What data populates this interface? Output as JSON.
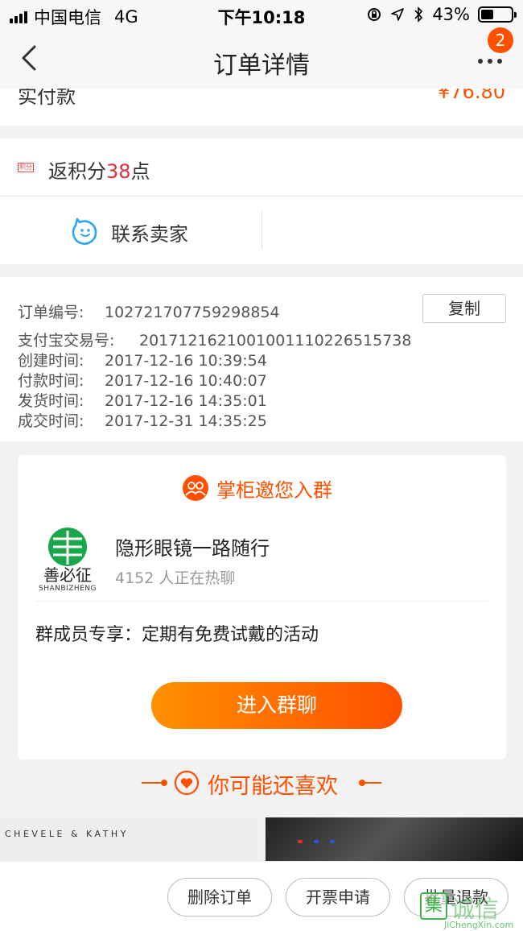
{
  "status_bar": {
    "carrier": "中国电信",
    "network": "4G",
    "time": "下午10:18",
    "battery_percent": "43%",
    "battery_level": 0.43
  },
  "nav": {
    "title": "订单详情",
    "badge_count": "2",
    "back_icon": "chevron-left-icon",
    "more_icon": "more-dots-icon"
  },
  "payment": {
    "label": "实付款",
    "value": "¥76.80"
  },
  "points": {
    "icon_text": "积分",
    "prefix": "返积分",
    "amount": "38",
    "suffix": "点"
  },
  "contact": {
    "label": "联系卖家",
    "icon": "chat-bubble-icon"
  },
  "order_info": {
    "copy_label": "复制",
    "lines": [
      {
        "label": "订单编号:",
        "value": "102721707759298854"
      },
      {
        "label": "支付宝交易号:",
        "value": "2017121621001001110226515738"
      },
      {
        "label": "创建时间:",
        "value": "2017-12-16 10:39:54"
      },
      {
        "label": "付款时间:",
        "value": "2017-12-16 10:40:07"
      },
      {
        "label": "发货时间:",
        "value": "2017-12-16 14:35:01"
      },
      {
        "label": "成交时间:",
        "value": "2017-12-31 14:35:25"
      }
    ]
  },
  "group": {
    "invite_title": "掌柜邀您入群",
    "logo_text": "善必征",
    "logo_sub": "SHANBIZHENG",
    "name": "隐形眼镜一路随行",
    "member_count": "4152 人正在热聊",
    "perk": "群成员专享：定期有免费试戴的活动",
    "join_label": "进入群聊"
  },
  "recommend": {
    "title": "你可能还喜欢",
    "product_1_brand": "CHEVELE & KATHY"
  },
  "actions": {
    "delete_label": "删除订单",
    "invoice_label": "开票申请",
    "refund_label": "批量退款"
  },
  "watermark": {
    "badge": "集",
    "text": "诚信",
    "url": "JiChengXin.com"
  },
  "colors": {
    "accent": "#ff5000",
    "points_red": "#e02e3b",
    "contact_blue": "#2ba6f5"
  }
}
